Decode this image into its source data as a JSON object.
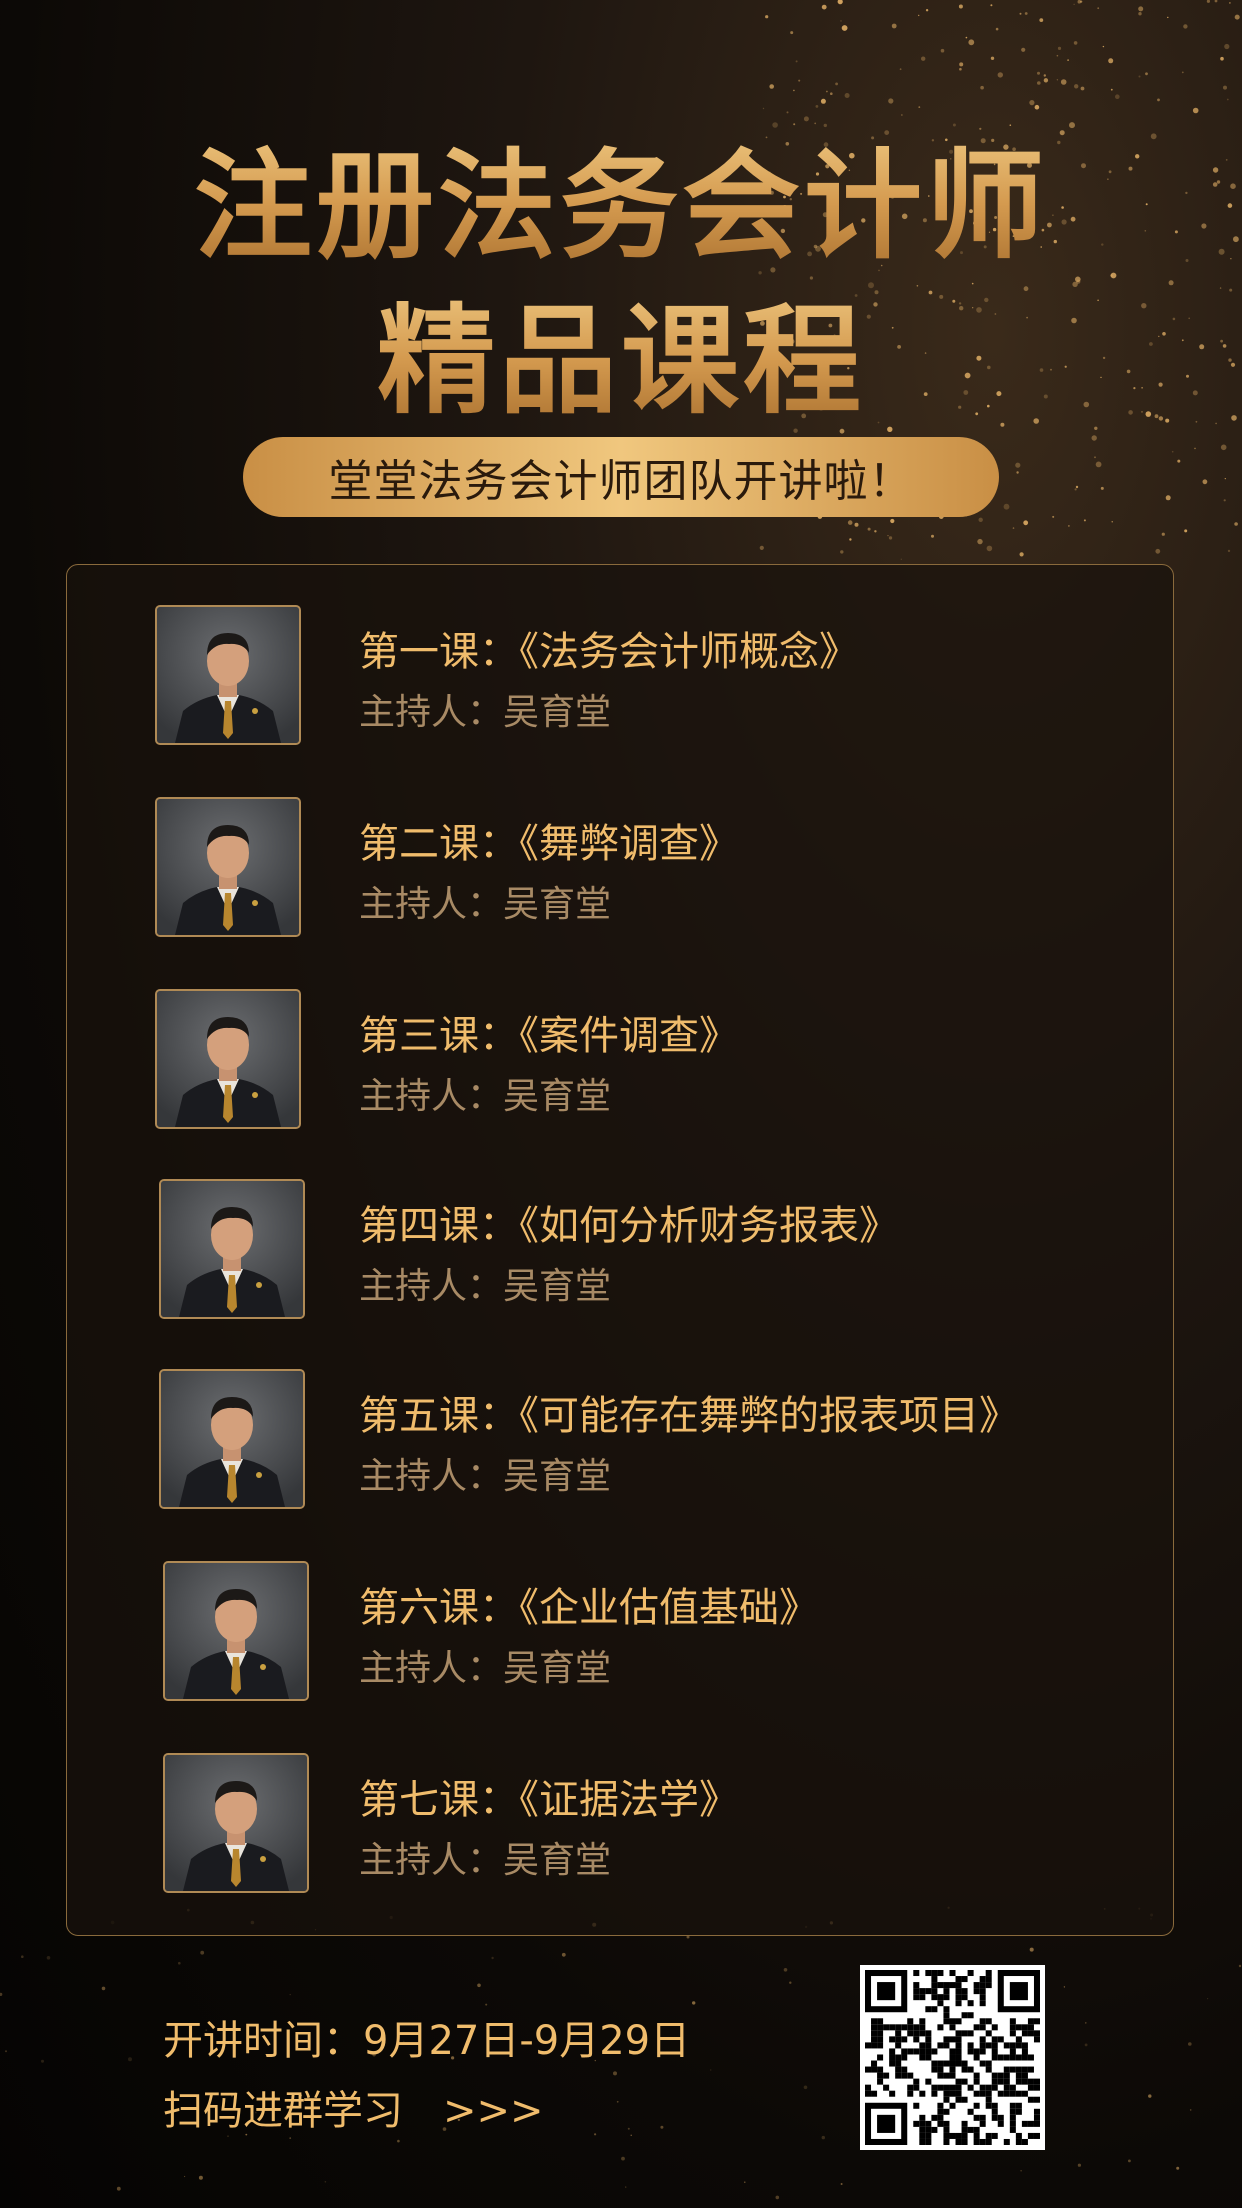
{
  "title": {
    "line1": "注册法务会计师",
    "line2": "精品课程"
  },
  "subtitle": "堂堂法务会计师团队开讲啦！",
  "courses": [
    {
      "title": "第一课：《法务会计师概念》",
      "host": "主持人：吴育堂"
    },
    {
      "title": "第二课：《舞弊调查》",
      "host": "主持人：吴育堂"
    },
    {
      "title": "第三课：《案件调查》",
      "host": "主持人：吴育堂"
    },
    {
      "title": "第四课：《如何分析财务报表》",
      "host": "主持人：吴育堂"
    },
    {
      "title": "第五课：《可能存在舞弊的报表项目》",
      "host": "主持人：吴育堂"
    },
    {
      "title": "第六课：《企业估值基础》",
      "host": "主持人：吴育堂"
    },
    {
      "title": "第七课：《证据法学》",
      "host": "主持人：吴育堂"
    }
  ],
  "footer": {
    "schedule": "开讲时间：9月27日-9月29日",
    "cta": "扫码进群学习　>>>"
  },
  "colors": {
    "gold": "#e9b35f",
    "background": "#0c0906",
    "pill": "#f0c77e"
  },
  "icons": {
    "qr": "qr-code-icon",
    "avatar": "host-portrait"
  }
}
